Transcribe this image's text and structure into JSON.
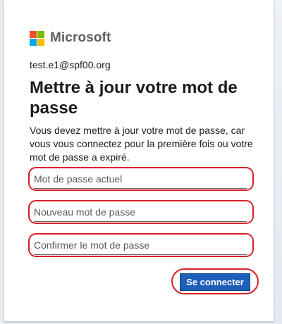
{
  "brand": {
    "name": "Microsoft",
    "logo_colors": [
      "#f25022",
      "#7fba00",
      "#00a4ef",
      "#ffb900"
    ]
  },
  "user_email": "test.e1@spf00.org",
  "title": "Mettre à jour votre mot de passe",
  "description": "Vous devez mettre à jour votre mot de passe, car vous vous connectez pour la première fois ou votre mot de passe a expiré.",
  "fields": [
    {
      "placeholder": "Mot de passe actuel",
      "value": ""
    },
    {
      "placeholder": "Nouveau mot de passe",
      "value": ""
    },
    {
      "placeholder": "Confirmer le mot de passe",
      "value": ""
    }
  ],
  "submit_label": "Se connecter",
  "colors": {
    "highlight_ring": "#d8202a",
    "primary_button": "#1f5fb8"
  }
}
